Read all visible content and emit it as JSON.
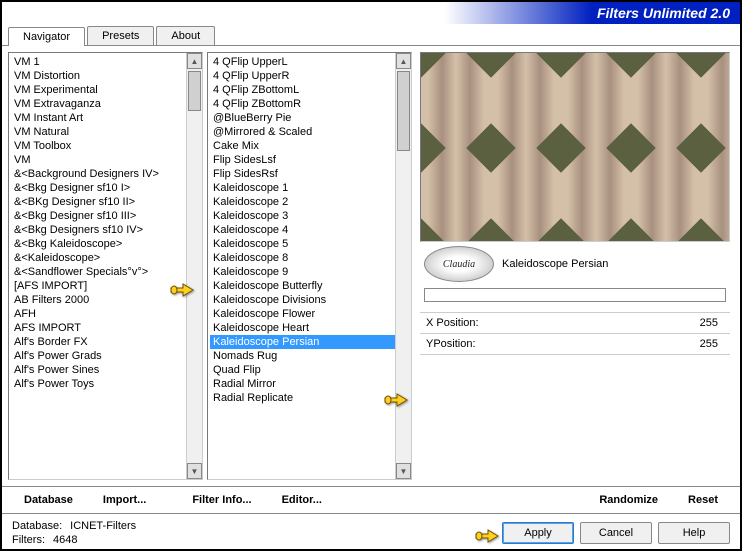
{
  "title": "Filters Unlimited 2.0",
  "tabs": [
    "Navigator",
    "Presets",
    "About"
  ],
  "active_tab": 0,
  "categories": [
    "VM 1",
    "VM Distortion",
    "VM Experimental",
    "VM Extravaganza",
    "VM Instant Art",
    "VM Natural",
    "VM Toolbox",
    "VM",
    "&<Background Designers IV>",
    "&<Bkg Designer sf10 I>",
    "&<BKg Designer sf10 II>",
    "&<Bkg Designer sf10 III>",
    "&<Bkg Designers sf10 IV>",
    "&<Bkg Kaleidoscope>",
    "&<Kaleidoscope>",
    "&<Sandflower Specials°v°>",
    "[AFS IMPORT]",
    "AB Filters 2000",
    "AFH",
    "AFS IMPORT",
    "Alf's Border FX",
    "Alf's Power Grads",
    "Alf's Power Sines",
    "Alf's Power Toys"
  ],
  "selected_category_index": 13,
  "filters": [
    "4 QFlip UpperL",
    "4 QFlip UpperR",
    "4 QFlip ZBottomL",
    "4 QFlip ZBottomR",
    "@BlueBerry Pie",
    "@Mirrored & Scaled",
    "Cake Mix",
    "Flip SidesLsf",
    "Flip SidesRsf",
    "Kaleidoscope 1",
    "Kaleidoscope 2",
    "Kaleidoscope 3",
    "Kaleidoscope 4",
    "Kaleidoscope 5",
    "Kaleidoscope 8",
    "Kaleidoscope 9",
    "Kaleidoscope Butterfly",
    "Kaleidoscope Divisions",
    "Kaleidoscope Flower",
    "Kaleidoscope Heart",
    "Kaleidoscope Persian",
    "Nomads Rug",
    "Quad Flip",
    "Radial Mirror",
    "Radial Replicate"
  ],
  "selected_filter_index": 20,
  "selected_filter_name": "Kaleidoscope Persian",
  "claudia_label": "Claudia",
  "params": [
    {
      "label": "X Position:",
      "value": "255"
    },
    {
      "label": "YPosition:",
      "value": "255"
    }
  ],
  "link_buttons": {
    "database": "Database",
    "import": "Import...",
    "filter_info": "Filter Info...",
    "editor": "Editor...",
    "randomize": "Randomize",
    "reset": "Reset"
  },
  "footer": {
    "db_label": "Database:",
    "db_value": "ICNET-Filters",
    "filters_label": "Filters:",
    "filters_value": "4648"
  },
  "buttons": {
    "apply": "Apply",
    "cancel": "Cancel",
    "help": "Help"
  }
}
